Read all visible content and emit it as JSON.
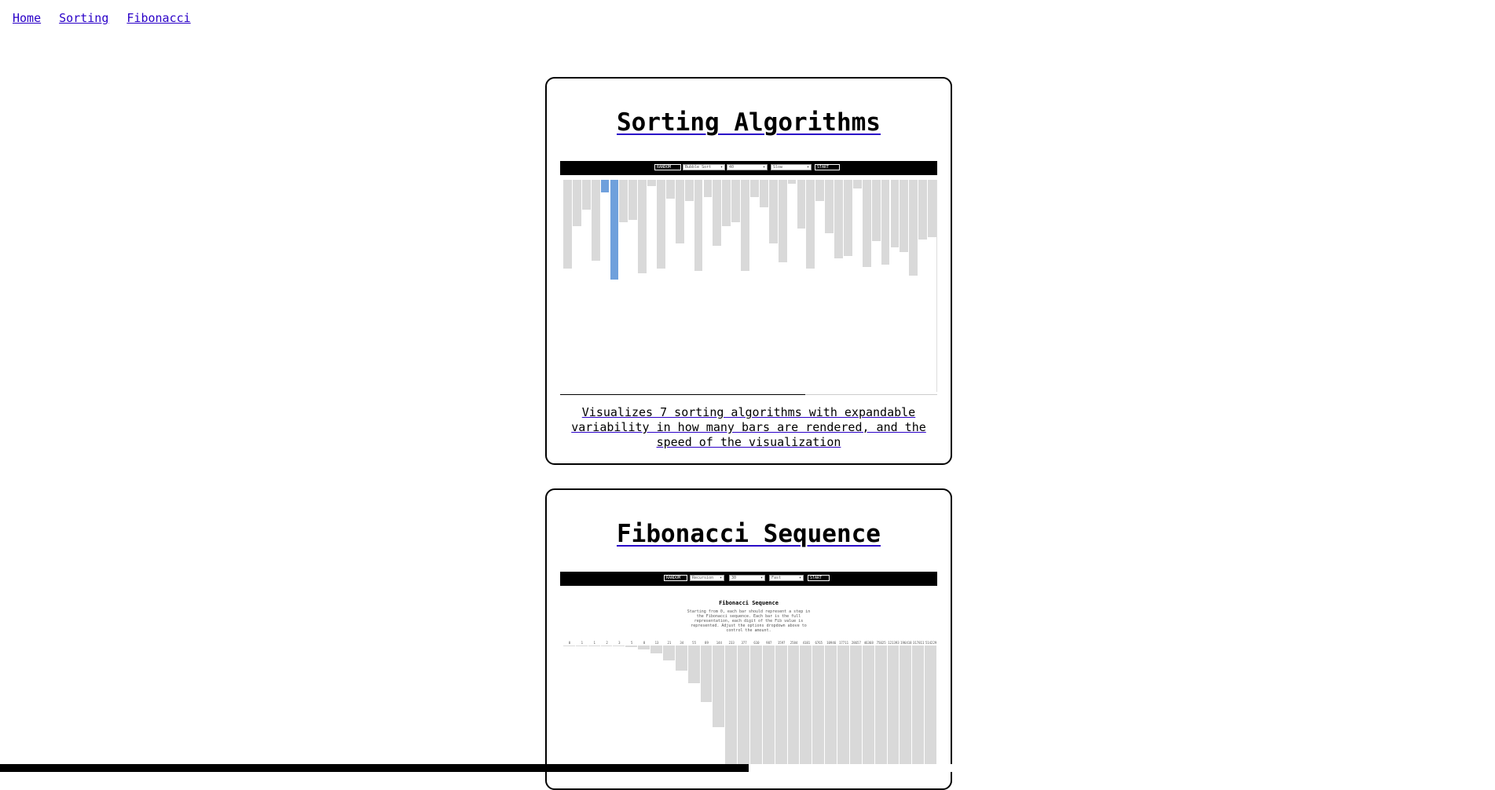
{
  "nav": {
    "home": "Home",
    "sorting": "Sorting",
    "fibonacci": "Fibonacci"
  },
  "sorting_card": {
    "title": "Sorting Algorithms",
    "description": "Visualizes 7 sorting algorithms with expandable variability in how many bars are rendered, and the speed of the visualization",
    "toolbar": {
      "random": "RANDOM",
      "algorithm": "Bubble Sort",
      "count": "40",
      "speed": "Slow",
      "start": "START"
    },
    "bar_values": [
      0.42,
      0.22,
      0.14,
      0.38,
      0.06,
      0.47,
      0.2,
      0.19,
      0.44,
      0.03,
      0.42,
      0.09,
      0.3,
      0.1,
      0.43,
      0.08,
      0.31,
      0.22,
      0.2,
      0.43,
      0.08,
      0.13,
      0.3,
      0.39,
      0.02,
      0.23,
      0.42,
      0.1,
      0.25,
      0.37,
      0.36,
      0.04,
      0.41,
      0.29,
      0.4,
      0.32,
      0.34,
      0.45,
      0.28,
      0.27
    ],
    "active_bars": [
      4,
      5
    ],
    "progress": 0.65
  },
  "fibonacci_card": {
    "title": "Fibonacci Sequence",
    "toolbar": {
      "random": "RANDOM",
      "algorithm": "Recursion",
      "count": "30",
      "speed": "Fast",
      "start": "START"
    },
    "preview_title": "Fibonacci Sequence",
    "preview_text": "Starting from 0, each bar should represent a step in the Fibonacci sequence. Each bar is the full representation, each digit of the Fib value is represented. Adjust the options dropdown above to control the amount.",
    "labels": [
      "0",
      "1",
      "1",
      "2",
      "3",
      "5",
      "8",
      "13",
      "21",
      "34",
      "55",
      "89",
      "144",
      "233",
      "377",
      "610",
      "987",
      "1597",
      "2584",
      "4181",
      "6765",
      "10946",
      "17711",
      "28657",
      "46368",
      "75025",
      "121393",
      "196418",
      "317811",
      "514229"
    ],
    "bar_values": [
      0.0,
      0.002,
      0.002,
      0.004,
      0.006,
      0.01,
      0.03,
      0.06,
      0.12,
      0.2,
      0.3,
      0.45,
      0.65,
      1,
      1,
      1,
      1,
      1,
      1,
      1,
      1,
      1,
      1,
      1,
      1,
      1,
      1,
      1,
      1,
      1
    ]
  },
  "scroll": {
    "position": 0.5
  }
}
